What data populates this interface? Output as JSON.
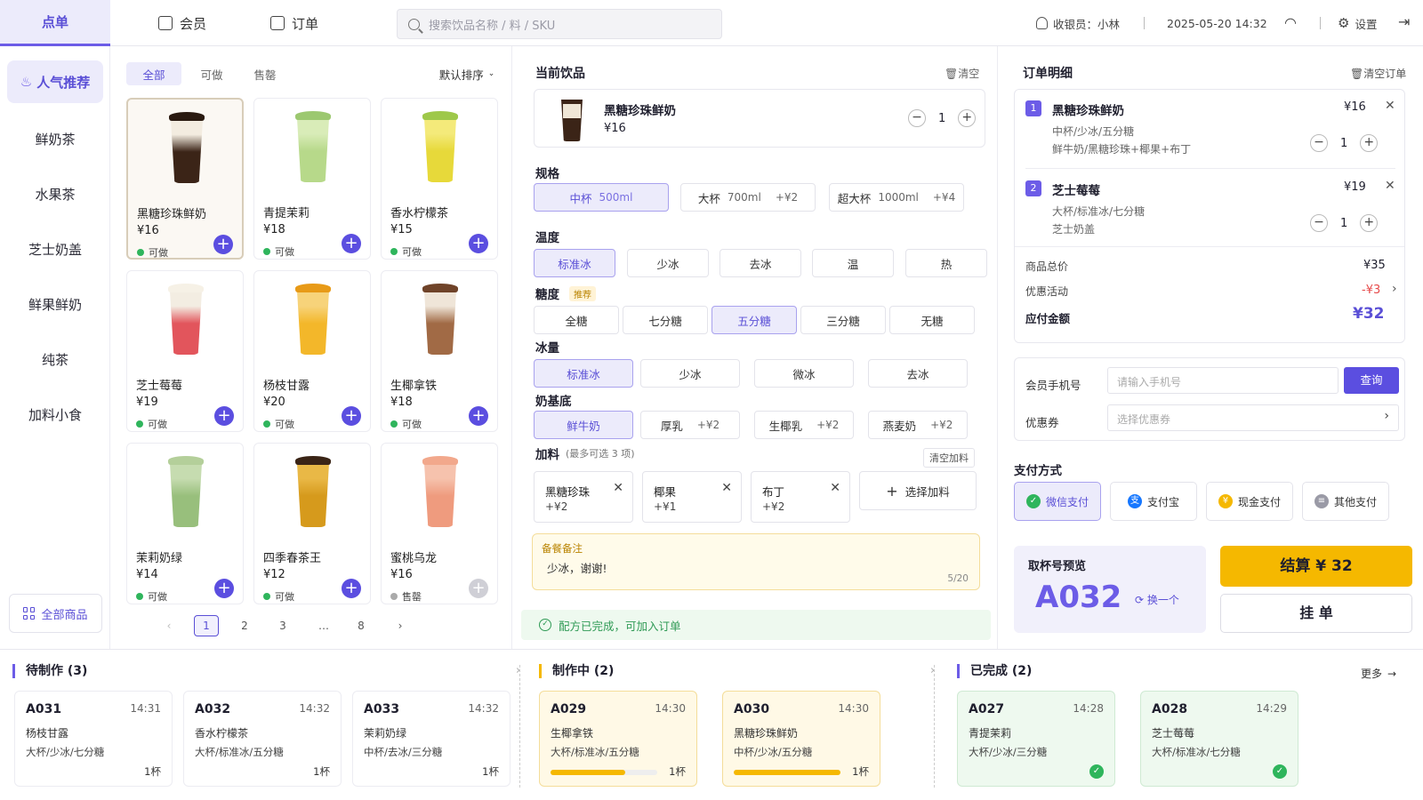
{
  "nav": {
    "tabs": [
      {
        "label": "点单",
        "icon": "none"
      },
      {
        "label": "会员",
        "icon": "member-icon"
      },
      {
        "label": "订单",
        "icon": "order-icon"
      }
    ],
    "search_placeholder": "搜索饮品名称 / 料 / SKU",
    "cashier": "收银员：小林",
    "datetime": "2025-05-20  14:32",
    "settings": "设置"
  },
  "categories": [
    "人气推荐",
    "鲜奶茶",
    "水果茶",
    "芝士奶盖",
    "鲜果鲜奶",
    "纯茶",
    "加料小食"
  ],
  "all_goods": "全部商品",
  "filters": {
    "tabs": [
      "全部",
      "可做",
      "售罄"
    ],
    "sort": "默认排序"
  },
  "products": [
    {
      "name": "黑糖珍珠鲜奶",
      "price": "¥16",
      "status": "可做",
      "cup": "#3b2417",
      "top": "#f3ece0",
      "lid": "#2a1a10"
    },
    {
      "name": "青提茉莉",
      "price": "¥18",
      "status": "可做",
      "cup": "#b7d98a",
      "top": "#d9ecb8",
      "lid": "#9cc870"
    },
    {
      "name": "香水柠檬茶",
      "price": "¥15",
      "status": "可做",
      "cup": "#e7d93a",
      "top": "#f4ea7a",
      "lid": "#9ec84a"
    },
    {
      "name": "芝士莓莓",
      "price": "¥19",
      "status": "可做",
      "cup": "#e2555c",
      "top": "#f3ede2",
      "lid": "#f6f1e6"
    },
    {
      "name": "杨枝甘露",
      "price": "¥20",
      "status": "可做",
      "cup": "#f3b72a",
      "top": "#f7d37a",
      "lid": "#e89a17"
    },
    {
      "name": "生椰拿铁",
      "price": "¥18",
      "status": "可做",
      "cup": "#a16a45",
      "top": "#efe5d8",
      "lid": "#6f4329"
    },
    {
      "name": "茉莉奶绿",
      "price": "¥14",
      "status": "可做",
      "cup": "#98bf7c",
      "top": "#c6dcb0",
      "lid": "#b4cf9a"
    },
    {
      "name": "四季春茶王",
      "price": "¥12",
      "status": "可做",
      "cup": "#d69a1c",
      "top": "#e9b846",
      "lid": "#3a2416"
    },
    {
      "name": "蜜桃乌龙",
      "price": "¥16",
      "status": "售罄",
      "cup": "#ef9b7e",
      "top": "#f6c2ad",
      "lid": "#f2a88c"
    }
  ],
  "pagination": {
    "pages": [
      "1",
      "2",
      "3",
      "…",
      "8"
    ],
    "prev": "‹",
    "next": "›"
  },
  "current": {
    "title": "当前饮品",
    "clear": "清空",
    "name": "黑糖珍珠鲜奶",
    "price": "¥16",
    "qty": "1"
  },
  "spec": {
    "title": "规格",
    "options": [
      {
        "name": "中杯",
        "vol": "500ml",
        "extra": ""
      },
      {
        "name": "大杯",
        "vol": "700ml",
        "extra": "+¥2"
      },
      {
        "name": "超大杯",
        "vol": "1000ml",
        "extra": "+¥4"
      }
    ]
  },
  "temp": {
    "title": "温度",
    "options": [
      "标准冰",
      "少冰",
      "去冰",
      "温",
      "热"
    ]
  },
  "sugar": {
    "title": "糖度",
    "badge": "推荐",
    "options": [
      "全糖",
      "七分糖",
      "五分糖",
      "三分糖",
      "无糖"
    ]
  },
  "ice": {
    "title": "冰量",
    "options": [
      "标准冰",
      "少冰",
      "微冰",
      "去冰"
    ]
  },
  "base": {
    "title": "奶基底",
    "options": [
      {
        "name": "鲜牛奶",
        "extra": ""
      },
      {
        "name": "厚乳",
        "extra": "+¥2"
      },
      {
        "name": "生椰乳",
        "extra": "+¥2"
      },
      {
        "name": "燕麦奶",
        "extra": "+¥2"
      }
    ]
  },
  "toppings": {
    "title": "加料",
    "hint": "(最多可选 3 项)",
    "clear": "清空加料",
    "items": [
      {
        "name": "黑糖珍珠",
        "price": "+¥2"
      },
      {
        "name": "椰果",
        "price": "+¥1"
      },
      {
        "name": "布丁",
        "price": "+¥2"
      }
    ],
    "add": "选择加料"
  },
  "note": {
    "title": "备餐备注",
    "text": "少冰，谢谢!",
    "count": "5/20"
  },
  "complete": "配方已完成，可加入订单",
  "order": {
    "title": "订单明细",
    "clear": "清空订单",
    "items": [
      {
        "no": "1",
        "name": "黑糖珍珠鲜奶",
        "price": "¥16",
        "spec": "中杯/少冰/五分糖",
        "extra": "鲜牛奶/黑糖珍珠+椰果+布丁",
        "qty": "1"
      },
      {
        "no": "2",
        "name": "芝士莓莓",
        "price": "¥19",
        "spec": "大杯/标准冰/七分糖",
        "extra": "芝士奶盖",
        "qty": "1"
      }
    ],
    "total_label": "商品总价",
    "total": "¥35",
    "discount_label": "优惠活动",
    "discount": "-¥3",
    "pay_label": "应付金额",
    "pay": "¥32",
    "member_label": "会员手机号",
    "member_placeholder": "请输入手机号",
    "query": "查询",
    "coupon_label": "优惠券",
    "coupon_placeholder": "选择优惠券",
    "pay_title": "支付方式",
    "payments": [
      {
        "label": "微信支付",
        "color": "#2fb55c",
        "glyph": "✓"
      },
      {
        "label": "支付宝",
        "color": "#1677ff",
        "glyph": "支"
      },
      {
        "label": "现金支付",
        "color": "#f5b800",
        "glyph": "¥"
      },
      {
        "label": "其他支付",
        "color": "#9a9aa6",
        "glyph": "≡"
      }
    ],
    "pickup_label": "取杯号预览",
    "pickup": "A032",
    "change": "换一个",
    "checkout": "结算  ¥ 32",
    "hold": "挂 单"
  },
  "queue": {
    "pending": {
      "title": "待制作 (3)",
      "items": [
        {
          "id": "A031",
          "time": "14:31",
          "name": "杨枝甘露",
          "spec": "大杯/少冰/七分糖",
          "count": "1杯"
        },
        {
          "id": "A032",
          "time": "14:32",
          "name": "香水柠檬茶",
          "spec": "大杯/标准冰/五分糖",
          "count": "1杯"
        },
        {
          "id": "A033",
          "time": "14:32",
          "name": "茉莉奶绿",
          "spec": "中杯/去冰/三分糖",
          "count": "1杯"
        }
      ]
    },
    "making": {
      "title": "制作中 (2)",
      "items": [
        {
          "id": "A029",
          "time": "14:30",
          "name": "生椰拿铁",
          "spec": "大杯/标准冰/五分糖",
          "count": "1杯",
          "progress": 0.7
        },
        {
          "id": "A030",
          "time": "14:30",
          "name": "黑糖珍珠鲜奶",
          "spec": "中杯/少冰/五分糖",
          "count": "1杯",
          "progress": 1.0
        }
      ]
    },
    "done": {
      "title": "已完成 (2)",
      "more": "更多",
      "items": [
        {
          "id": "A027",
          "time": "14:28",
          "name": "青提茉莉",
          "spec": "大杯/少冰/三分糖"
        },
        {
          "id": "A028",
          "time": "14:29",
          "name": "芝士莓莓",
          "spec": "大杯/标准冰/七分糖"
        }
      ]
    }
  }
}
